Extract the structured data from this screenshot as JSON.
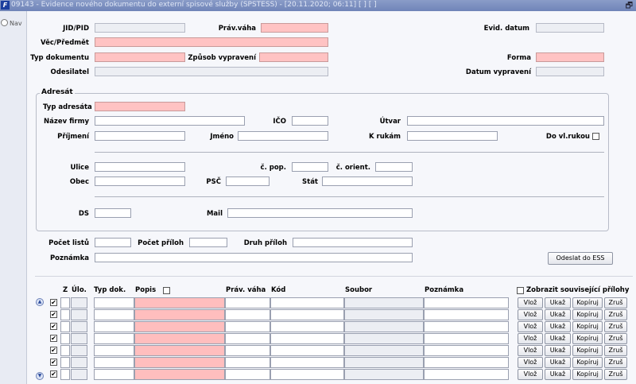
{
  "window": {
    "title": "09143 - Evidence nového dokumentu do externí spisové služby (SPSTESS) - [20.11.2020; 06:11] [ ] [ ]",
    "app_icon": "F"
  },
  "nav": {
    "label": "Nav"
  },
  "header": {
    "jid_label": "JID/PID",
    "prav_vaha_label": "Práv.váha",
    "evid_datum_label": "Evid. datum",
    "vec_label": "Věc/Předmět",
    "typ_dokumentu_label": "Typ dokumentu",
    "zpusob_label": "Způsob vypravení",
    "forma_label": "Forma",
    "odesilatel_label": "Odesilatel",
    "datum_vypraveni_label": "Datum vypravení"
  },
  "adresat": {
    "group_title": "Adresát",
    "typ_adresata_label": "Typ adresáta",
    "nazev_firmy_label": "Název firmy",
    "ico_label": "IČO",
    "utvar_label": "Útvar",
    "prijmeni_label": "Příjmení",
    "jmeno_label": "Jméno",
    "k_rukam_label": "K rukám",
    "do_vl_rukou_label": "Do vl.rukou",
    "ulice_label": "Ulice",
    "c_pop_label": "č. pop.",
    "c_orient_label": "č. orient.",
    "obec_label": "Obec",
    "psc_label": "PSČ",
    "stat_label": "Stát",
    "ds_label": "DS",
    "mail_label": "Mail"
  },
  "meta": {
    "pocet_listu_label": "Počet listů",
    "pocet_priloh_label": "Počet příloh",
    "druh_priloh_label": "Druh příloh",
    "poznamka_label": "Poznámka",
    "odeslat_button": "Odeslat do ESS"
  },
  "attachments": {
    "columns": {
      "z": "Z",
      "ulo": "Úlo.",
      "typ_dok": "Typ dok.",
      "popis": "Popis",
      "prav_vaha": "Práv. váha",
      "kod": "Kód",
      "soubor": "Soubor",
      "poznamka": "Poznámka"
    },
    "show_related_label": "Zobrazit související přílohy",
    "row_buttons": {
      "vloz": "Vlož",
      "ukaz": "Ukaž",
      "kopiruj": "Kopíruj",
      "zrus": "Zruš"
    },
    "rows": [
      {
        "checked": "✔"
      },
      {
        "checked": "✔"
      },
      {
        "checked": "✔"
      },
      {
        "checked": "✔"
      },
      {
        "checked": "✔"
      },
      {
        "checked": "✔"
      },
      {
        "checked": "✔"
      }
    ],
    "scroll_up_icon": "▲",
    "scroll_down_icon": "▼"
  },
  "window_icons": {
    "maximize": "🗗"
  }
}
